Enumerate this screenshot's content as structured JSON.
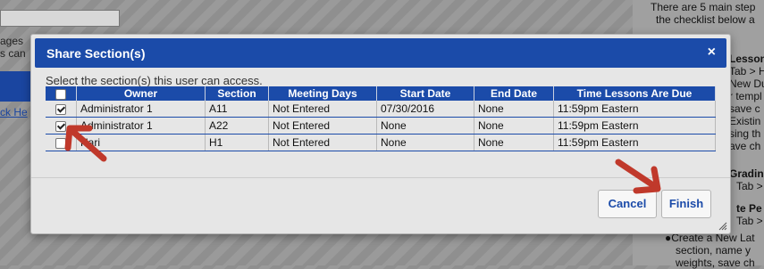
{
  "background": {
    "left_line_1": "ages",
    "left_line_2": "s can",
    "left_link": "ck He",
    "right_lines": [
      "There are 5 main step",
      "the checklist below a",
      "Lesson",
      "Tab > H",
      "New Due",
      "r templ",
      "save c",
      "Existin",
      "sing th",
      "ave ch",
      "Gradin",
      "Tab >",
      "te Pe",
      "Tab >",
      "●Create a New Lat",
      "section, name y",
      "weights, save ch"
    ]
  },
  "dialog": {
    "title": "Share Section(s)",
    "close_label": "×",
    "instruction": "Select the section(s) this user can access.",
    "columns": [
      "Owner",
      "Section",
      "Meeting Days",
      "Start Date",
      "End Date",
      "Time Lessons Are Due"
    ],
    "rows": [
      {
        "checked": true,
        "owner": "Administrator 1",
        "section": "A11",
        "meeting_days": "Not Entered",
        "start_date": "07/30/2016",
        "end_date": "None",
        "time_due": "11:59pm Eastern"
      },
      {
        "checked": true,
        "owner": "Administrator 1",
        "section": "A22",
        "meeting_days": "Not Entered",
        "start_date": "None",
        "end_date": "None",
        "time_due": "11:59pm Eastern"
      },
      {
        "checked": false,
        "owner": "Hari",
        "section": "H1",
        "meeting_days": "Not Entered",
        "start_date": "None",
        "end_date": "None",
        "time_due": "11:59pm Eastern"
      }
    ],
    "cancel_label": "Cancel",
    "finish_label": "Finish"
  },
  "colors": {
    "header_blue": "#1b4ba9",
    "annotation_arrow": "#c0392b"
  }
}
